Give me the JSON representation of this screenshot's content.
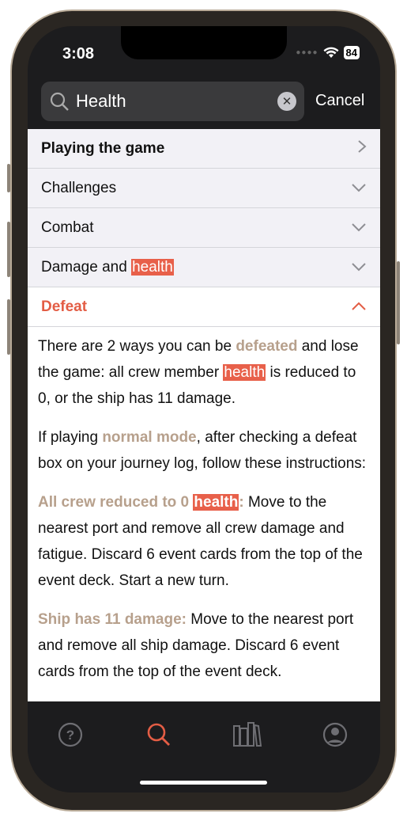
{
  "status": {
    "time": "3:08",
    "battery": "84"
  },
  "search": {
    "value": "Health",
    "cancel": "Cancel"
  },
  "rows": [
    {
      "label": "Playing the game",
      "icon": "chevron-right"
    },
    {
      "label": "Challenges",
      "icon": "chevron-down"
    },
    {
      "label": "Combat",
      "icon": "chevron-down"
    },
    {
      "label_pre": "Damage and ",
      "label_hl": "health",
      "icon": "chevron-down"
    },
    {
      "label": "Defeat",
      "icon": "chevron-up"
    }
  ],
  "content": {
    "p1": {
      "a": "There are 2 ways you can be ",
      "b": "defeated",
      "c": " and lose the game: all crew member ",
      "d": "health",
      "e": " is reduced to 0, or the ship has 11 damage."
    },
    "p2": {
      "a": "If playing ",
      "b": "normal mode",
      "c": ", after checking a defeat box on your journey log, follow these instructions:"
    },
    "p3": {
      "a": "All crew reduced to 0 ",
      "b": "health",
      "c": ":",
      "d": " Move to the nearest port and remove all crew damage and fatigue. Discard 6 event cards from the top of the event deck. Start a new turn."
    },
    "p4": {
      "a": "Ship has 11 damage:",
      "b": " Move to the nearest port and remove all ship damage. Discard 6 event cards from the top of the event deck."
    }
  },
  "tabs": [
    "help",
    "search",
    "library",
    "profile"
  ],
  "colors": {
    "accent": "#e35d45",
    "highlight": "#e8604a",
    "keyword": "#b7a08c"
  }
}
